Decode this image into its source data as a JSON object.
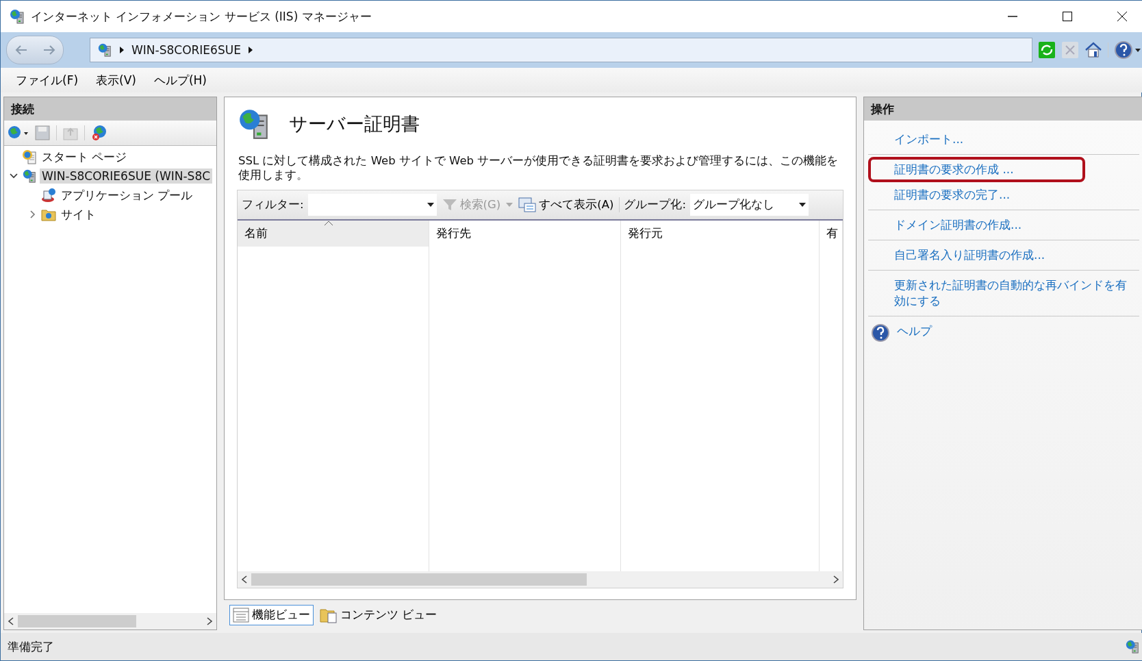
{
  "window": {
    "title": "インターネット インフォメーション サービス (IIS) マネージャー"
  },
  "address_bar": {
    "path": [
      "WIN-S8CORIE6SUE"
    ]
  },
  "menu": [
    "ファイル(F)",
    "表示(V)",
    "ヘルプ(H)"
  ],
  "connections": {
    "title": "接続",
    "tree": [
      {
        "label": "スタート ページ",
        "kind": "start",
        "selected": false
      },
      {
        "label": "WIN-S8CORIE6SUE (WIN-S8C",
        "kind": "server",
        "expanded": true,
        "selected": true,
        "children": [
          {
            "label": "アプリケーション プール",
            "kind": "pool",
            "selected": false
          },
          {
            "label": "サイト",
            "kind": "folder",
            "expanded": false,
            "selected": false
          }
        ]
      }
    ]
  },
  "feature": {
    "title": "サーバー証明書",
    "description": "SSL に対して構成された Web サイトで Web サーバーが使用できる証明書を要求および管理するには、この機能を使用します。",
    "filter_label": "フィルター:",
    "search_button": {
      "label": "検索(G)",
      "disabled": true
    },
    "show_all_button": "すべて表示(A)",
    "group_label": "グループ化:",
    "group_value": "グループ化なし",
    "columns": [
      {
        "label": "名前",
        "sorted": true
      },
      {
        "label": "発行先",
        "sorted": false
      },
      {
        "label": "発行元",
        "sorted": false
      },
      {
        "label": "有",
        "sorted": false
      }
    ]
  },
  "view_tabs": [
    {
      "label": "機能ビュー",
      "kind": "features",
      "selected": true
    },
    {
      "label": "コンテンツ ビュー",
      "kind": "content",
      "selected": false
    }
  ],
  "actions": {
    "title": "操作",
    "groups": [
      {
        "items": [
          {
            "label": "インポート...",
            "kind": "link",
            "highlighted": false
          }
        ]
      },
      {
        "items": [
          {
            "label": "証明書の要求の作成 ...",
            "kind": "link",
            "highlighted": true
          },
          {
            "label": "証明書の要求の完了...",
            "kind": "link",
            "highlighted": false
          }
        ]
      },
      {
        "items": [
          {
            "label": "ドメイン証明書の作成...",
            "kind": "link",
            "highlighted": false
          }
        ]
      },
      {
        "items": [
          {
            "label": "自己署名入り証明書の作成...",
            "kind": "link",
            "highlighted": false
          }
        ]
      },
      {
        "items": [
          {
            "label": "更新された証明書の自動的な再バインドを有効にする",
            "kind": "link",
            "highlighted": false
          }
        ]
      },
      {
        "items": [
          {
            "label": "ヘルプ",
            "kind": "help",
            "highlighted": false
          }
        ]
      }
    ]
  },
  "status_bar": {
    "text": "準備完了"
  }
}
